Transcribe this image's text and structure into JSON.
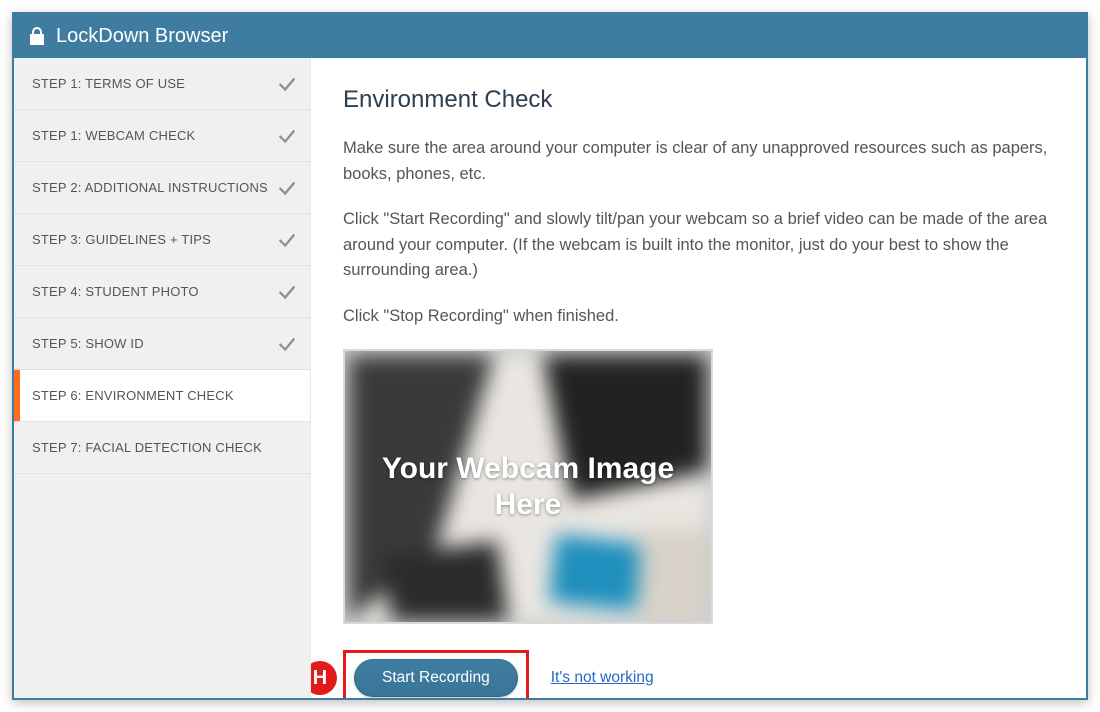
{
  "app_title": "LockDown Browser",
  "sidebar": {
    "items": [
      {
        "label": "STEP 1: TERMS OF USE",
        "completed": true,
        "active": false
      },
      {
        "label": "STEP 1: WEBCAM CHECK",
        "completed": true,
        "active": false
      },
      {
        "label": "STEP 2: ADDITIONAL INSTRUCTIONS",
        "completed": true,
        "active": false
      },
      {
        "label": "STEP 3: GUIDELINES + TIPS",
        "completed": true,
        "active": false
      },
      {
        "label": "STEP 4: STUDENT PHOTO",
        "completed": true,
        "active": false
      },
      {
        "label": "STEP 5: SHOW ID",
        "completed": true,
        "active": false
      },
      {
        "label": "STEP 6: ENVIRONMENT CHECK",
        "completed": false,
        "active": true
      },
      {
        "label": "STEP 7: FACIAL DETECTION CHECK",
        "completed": false,
        "active": false
      }
    ]
  },
  "main": {
    "heading": "Environment Check",
    "paragraphs": [
      "Make sure the area around your computer is clear of any unapproved resources such as papers, books, phones, etc.",
      "Click \"Start Recording\" and slowly tilt/pan your webcam so a brief video can be made of the area around your computer. (If the webcam is built into the monitor, just do your best to show the surrounding area.)",
      "Click \"Stop Recording\" when finished."
    ],
    "webcam_placeholder": "Your Webcam Image Here",
    "start_button": "Start Recording",
    "not_working_link": "It's not working"
  },
  "annotation": {
    "marker": "H"
  },
  "colors": {
    "brand": "#3e7ca0",
    "accent_orange": "#ff6b1a",
    "annotation_red": "#e21a1a",
    "link_blue": "#2668c6"
  }
}
